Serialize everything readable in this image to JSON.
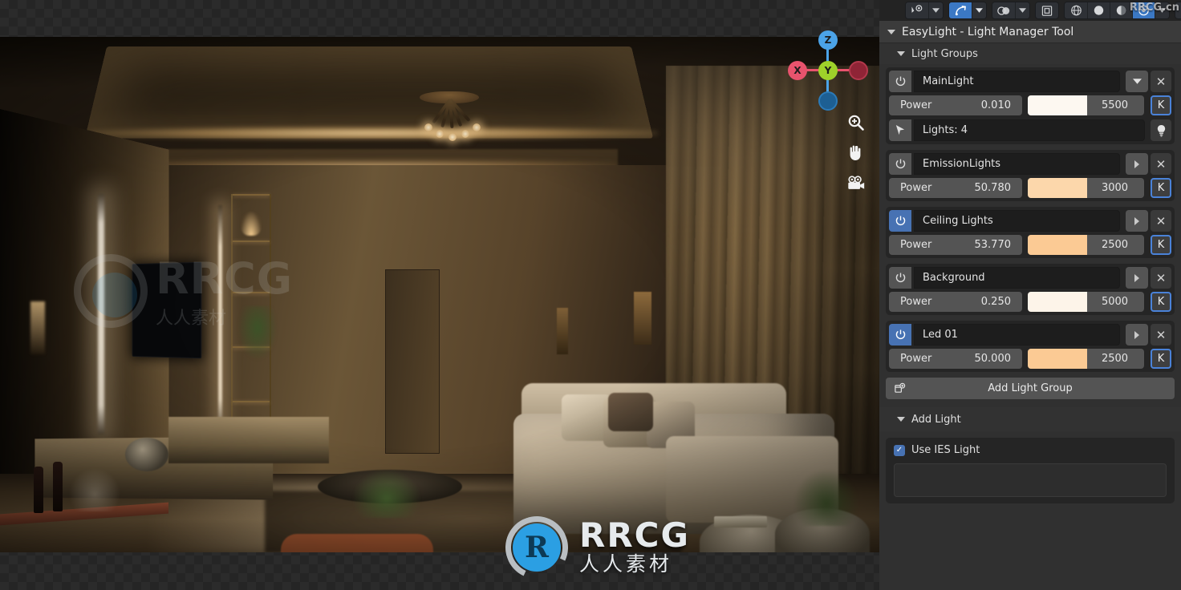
{
  "topbar": {
    "groups": [
      {
        "buttons": [
          {
            "icon": "object-visibility-icon",
            "label": "",
            "active": false
          },
          {
            "icon": "chevron-down-icon",
            "label": "",
            "active": false
          }
        ]
      },
      {
        "buttons": [
          {
            "icon": "snap-magnet-icon",
            "label": "",
            "active": true
          },
          {
            "icon": "chevron-down-icon",
            "label": "",
            "active": false
          }
        ]
      },
      {
        "buttons": [
          {
            "icon": "proportional-edit-icon",
            "label": "",
            "active": false
          },
          {
            "icon": "chevron-down-icon",
            "label": "",
            "active": false
          }
        ]
      },
      {
        "buttons": [
          {
            "icon": "overlays-icon",
            "label": "",
            "active": false
          }
        ]
      },
      {
        "buttons": [
          {
            "icon": "shading-wireframe-icon",
            "label": "",
            "active": false
          },
          {
            "icon": "shading-solid-icon",
            "label": "",
            "active": false
          },
          {
            "icon": "shading-material-icon",
            "label": "",
            "active": false
          },
          {
            "icon": "shading-rendered-icon",
            "label": "",
            "active": true
          },
          {
            "icon": "chevron-down-icon",
            "label": "",
            "active": false
          }
        ]
      }
    ],
    "watermark": "RRCG.cn"
  },
  "viewport": {
    "gizmo": {
      "axes": [
        {
          "name": "z-axis-positive",
          "label": "Z",
          "color": "#4ba3e8"
        },
        {
          "name": "y-axis-positive",
          "label": "Y",
          "color": "#9ed12a"
        },
        {
          "name": "x-axis-positive",
          "label": "X",
          "color": "#e8536d"
        },
        {
          "name": "x-axis-negative",
          "label": "",
          "color": "#8f2436"
        },
        {
          "name": "z-axis-negative",
          "label": "",
          "color": "#1d5f93"
        }
      ]
    },
    "tools": [
      {
        "icon": "zoom-magnifier-icon",
        "name": "zoom-tool"
      },
      {
        "icon": "pan-hand-icon",
        "name": "pan-tool"
      },
      {
        "icon": "camera-icon",
        "name": "camera-view-tool"
      }
    ],
    "watermark_faint": {
      "text": "RRCG",
      "sub": "人人素材"
    },
    "watermark_main": {
      "text": "RRCG",
      "sub": "人人素材"
    }
  },
  "panel": {
    "title": "EasyLight - Light Manager Tool",
    "sections": {
      "light_groups": {
        "label": "Light Groups",
        "power_label": "Power",
        "kelvin_label": "K",
        "expanded_arrow": "chevron-down-icon",
        "collapsed_arrow": "triangle-right-icon",
        "delete_label": "✕",
        "groups": [
          {
            "name": "MainLight",
            "enabled": false,
            "power": "0.010",
            "temperature": "5500",
            "color": "#fdf8f1",
            "expanded": true,
            "lights_label": "Lights: 4"
          },
          {
            "name": "EmissionLights",
            "enabled": false,
            "power": "50.780",
            "temperature": "3000",
            "color": "#fcd7ab",
            "expanded": false
          },
          {
            "name": "Ceiling Lights",
            "enabled": true,
            "power": "53.770",
            "temperature": "2500",
            "color": "#fbca94",
            "expanded": false
          },
          {
            "name": "Background",
            "enabled": false,
            "power": "0.250",
            "temperature": "5000",
            "color": "#fdf4e9",
            "expanded": false
          },
          {
            "name": "Led 01",
            "enabled": true,
            "power": "50.000",
            "temperature": "2500",
            "color": "#fbca94",
            "expanded": false
          }
        ],
        "add_group_button": "Add Light Group"
      },
      "add_light": {
        "label": "Add Light",
        "use_ies_label": "Use IES Light",
        "use_ies_checked": true
      }
    }
  },
  "colors": {
    "accent_blue": "#4772b3",
    "panel_bg": "#303030",
    "card_bg": "#252525",
    "field_bg": "#1d1d1d",
    "button_gray": "#545454"
  }
}
